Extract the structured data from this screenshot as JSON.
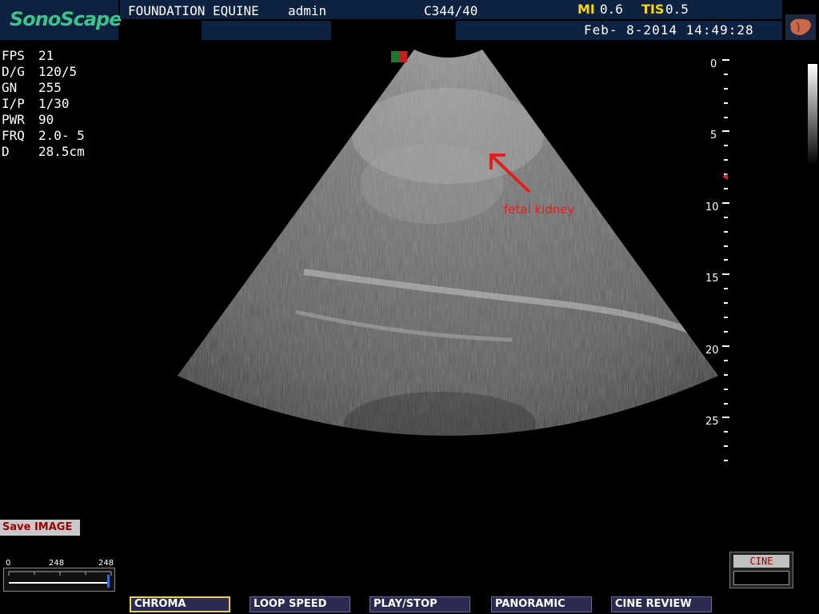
{
  "header": {
    "logo": "SonoScape",
    "institution": "FOUNDATION EQUINE",
    "user": "admin",
    "probe": "C344/40",
    "mi_label": "MI",
    "mi_value": "0.6",
    "tis_label": "TIS",
    "tis_value": "0.5",
    "datetime": "Feb- 8-2014 14:49:28",
    "organ_icon": "liver-organ-icon"
  },
  "params": [
    {
      "label": "FPS",
      "value": "21"
    },
    {
      "label": "D/G",
      "value": "120/5"
    },
    {
      "label": "GN",
      "value": "255"
    },
    {
      "label": "I/P",
      "value": "1/30"
    },
    {
      "label": "PWR",
      "value": "90"
    },
    {
      "label": "FRQ",
      "value": "2.0- 5"
    },
    {
      "label": "D",
      "value": "28.5cm"
    }
  ],
  "depth_scale": [
    "0",
    "5",
    "10",
    "15",
    "20",
    "25"
  ],
  "annotation": "fetal kidney",
  "annotation_color": "#e02020",
  "save_button": "Save IMAGE",
  "cine_slider": {
    "min": "0",
    "mid": "248",
    "max": "248"
  },
  "cine_indicator": "CINE",
  "softkeys": [
    "CHROMA",
    "LOOP SPEED",
    "PLAY/STOP",
    "PANORAMIC",
    "CINE REVIEW"
  ],
  "accent_colors": {
    "header_bg": "#0c2240",
    "logo": "#3ec48a",
    "label_yellow": "#ffd700",
    "softkey_selected": "#e8d15a"
  }
}
